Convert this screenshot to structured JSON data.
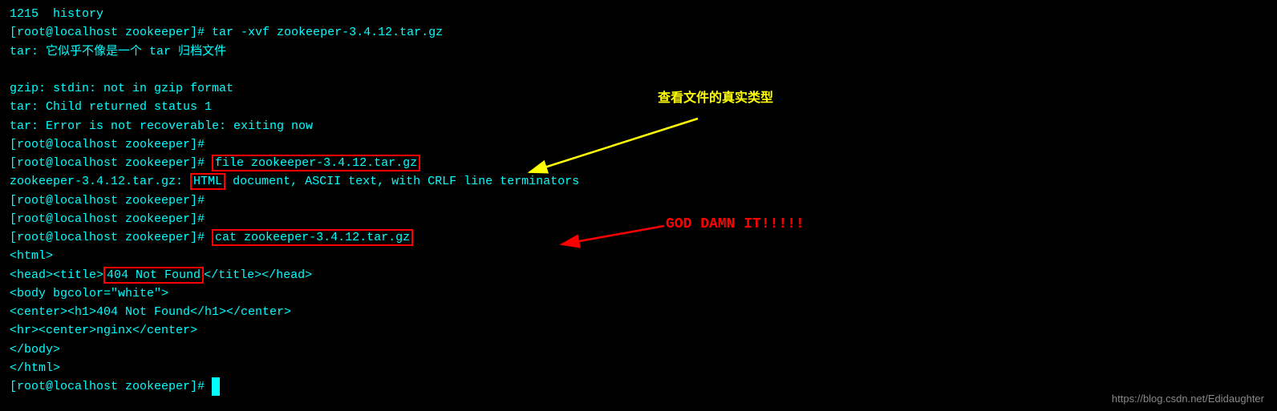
{
  "terminal": {
    "lines": [
      {
        "id": "l1",
        "text": "1215  history"
      },
      {
        "id": "l2",
        "text": "[root@localhost zookeeper]# tar -xvf zookeeper-3.4.12.tar.gz"
      },
      {
        "id": "l3",
        "text": "tar: 它似乎不像是一个 tar 归档文件"
      },
      {
        "id": "l4",
        "text": ""
      },
      {
        "id": "l5",
        "text": "gzip: stdin: not in gzip format"
      },
      {
        "id": "l6",
        "text": "tar: Child returned status 1"
      },
      {
        "id": "l7",
        "text": "tar: Error is not recoverable: exiting now"
      },
      {
        "id": "l8",
        "text": "[root@localhost zookeeper]#"
      },
      {
        "id": "l9",
        "text": "[root@localhost zookeeper]# file zookeeper-3.4.12.tar.gz",
        "highlight_cmd": "file zookeeper-3.4.12.tar.gz"
      },
      {
        "id": "l10",
        "text": "zookeeper-3.4.12.tar.gz: HTML document, ASCII text, with CRLF line terminators",
        "highlight_html": "HTML"
      },
      {
        "id": "l11",
        "text": "[root@localhost zookeeper]#"
      },
      {
        "id": "l12",
        "text": "[root@localhost zookeeper]#"
      },
      {
        "id": "l13",
        "text": "[root@localhost zookeeper]# cat zookeeper-3.4.12.tar.gz",
        "highlight_cmd": "cat zookeeper-3.4.12.tar.gz"
      },
      {
        "id": "l14",
        "text": "<html>"
      },
      {
        "id": "l15",
        "text": "<head><title>404 Not Found</title></head>",
        "highlight_notfound": "404 Not Found"
      },
      {
        "id": "l16",
        "text": "<body bgcolor=\"white\">"
      },
      {
        "id": "l17",
        "text": "<center><h1>404 Not Found</h1></center>"
      },
      {
        "id": "l18",
        "text": "<hr><center>nginx</center>"
      },
      {
        "id": "l19",
        "text": "</body>"
      },
      {
        "id": "l20",
        "text": "</html>"
      },
      {
        "id": "l21",
        "text": "[root@localhost zookeeper]# "
      }
    ]
  },
  "annotations": {
    "yellow": "查看文件的真实类型",
    "red": "GOD DAMN IT!!!!!"
  },
  "watermark": "https://blog.csdn.net/Edidaughter"
}
